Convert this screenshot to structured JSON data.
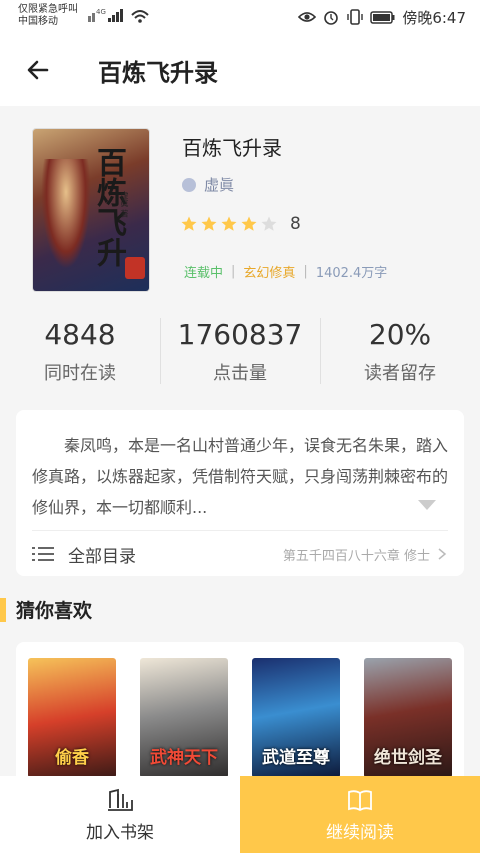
{
  "status_bar": {
    "carrier_line1": "仅限紧急呼叫",
    "carrier_line2": "中国移动",
    "time": "傍晚6:47"
  },
  "header": {
    "title": "百炼飞升录"
  },
  "book": {
    "title": "百炼飞升录",
    "author": "虚眞",
    "rating": 4,
    "rating_max": 5,
    "rating_score": "8",
    "status_tag": "连载中",
    "genre_tag": "玄幻修真",
    "word_count": "1402.4万字",
    "cover_title_chars": "百炼飞升",
    "cover_author": "虚眞 著"
  },
  "stats": [
    {
      "value": "4848",
      "label": "同时在读"
    },
    {
      "value": "1760837",
      "label": "点击量"
    },
    {
      "value": "20%",
      "label": "读者留存"
    }
  ],
  "intro": {
    "text": "秦凤鸣，本是一名山村普通少年，误食无名朱果，踏入修真路，以炼器起家，凭借制符天赋，只身闯荡荆棘密布的修仙界，本一切都顺利..."
  },
  "toc": {
    "label": "全部目录",
    "latest_chapter": "第五千四百八十六章 修士"
  },
  "recommend": {
    "title": "猜你喜欢",
    "books": [
      {
        "cover_text": "偷香"
      },
      {
        "cover_text": "武神天下"
      },
      {
        "cover_text": "武道至尊"
      },
      {
        "cover_text": "绝世剑圣"
      }
    ]
  },
  "bottom_bar": {
    "shelf_label": "加入书架",
    "read_label": "继续阅读"
  },
  "colors": {
    "accent": "#ffc84a",
    "status_green": "#5ac06a",
    "genre_orange": "#e8a82a",
    "star_filled": "#ffc84a",
    "star_empty": "#dddddd"
  },
  "icons": [
    "back-arrow-icon",
    "eye-icon",
    "alarm-icon",
    "vibrate-icon",
    "battery-icon",
    "signal-icon",
    "wifi-icon",
    "star-icon",
    "toc-list-icon",
    "chevron-right-icon",
    "bookshelf-icon",
    "open-book-icon"
  ]
}
